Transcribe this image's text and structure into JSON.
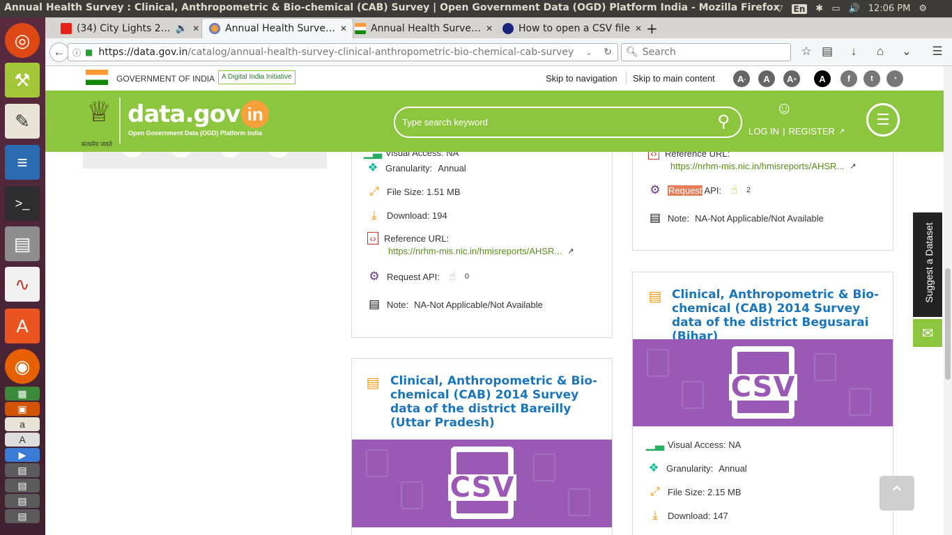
{
  "window": {
    "title": "Annual Health Survey : Clinical, Anthropometric & Bio-chemical (CAB) Survey | Open Government Data (OGD) Platform India - Mozilla Firefox",
    "keyboard": "En",
    "clock": "12:06 PM"
  },
  "tabs": [
    {
      "label": "(34) City Lights 2…"
    },
    {
      "label": "Annual Health Surve…"
    },
    {
      "label": "Annual Health Surve…"
    },
    {
      "label": "How to open a CSV file"
    }
  ],
  "browser": {
    "url_host": "https://data.gov.in",
    "url_path": "/catalog/annual-health-survey-clinical-anthropometric-bio-chemical-cab-survey",
    "search_placeholder": "Search"
  },
  "gov_strip": {
    "gov_label": "GOVERNMENT OF INDIA",
    "initiative": "A Digital India Initiative",
    "skip_nav": "Skip to navigation",
    "skip_main": "Skip to main content",
    "font_minus": "A",
    "font_normal": "A",
    "font_plus": "A",
    "contrast": "A"
  },
  "header": {
    "logo_main": "data.gov",
    "logo_in": "in",
    "logo_sub": "Open Government Data (OGD) Platform India",
    "emblem_motto": "सत्यमेव जयते",
    "search_placeholder": "Type search keyword",
    "login": "LOG IN",
    "separator": "|",
    "register": "REGISTER"
  },
  "card_left_top": {
    "visual_access": "Visual Access: NA",
    "granularity_label": "Granularity:",
    "granularity_value": "Annual",
    "file_size": "File Size: 1.51 MB",
    "download": "Download: 194",
    "reference_label": "Reference URL:",
    "reference_url": "https://nrhm-mis.nic.in/hmisreports/AHSR...",
    "request_api": "Request API:",
    "api_count": "0",
    "note_label": "Note:",
    "note_value": "NA-Not Applicable/Not Available"
  },
  "card_right_top": {
    "reference_label": "Reference URL:",
    "reference_url": "https://nrhm-mis.nic.in/hmisreports/AHSR...",
    "request_word": "Request",
    "api_word": "API:",
    "api_count": "2",
    "note_label": "Note:",
    "note_value": "NA-Not Applicable/Not Available"
  },
  "card_bareilly": {
    "title": "Clinical, Anthropometric & Bio-chemical (CAB) 2014 Survey data of the district Bareilly (Uttar Pradesh)",
    "csv": "CSV"
  },
  "card_begusarai": {
    "title": "Clinical, Anthropometric & Bio-chemical (CAB) 2014 Survey data of the district Begusarai (Bihar)",
    "csv": "CSV",
    "visual_access": "Visual Access: NA",
    "granularity_label": "Granularity:",
    "granularity_value": "Annual",
    "file_size": "File Size: 2.15 MB",
    "download": "Download: 147"
  },
  "sidebar_widgets": {
    "suggest": "Suggest a Dataset"
  },
  "colors": {
    "green": "#8cc63f",
    "purple": "#9b59b6",
    "title_blue": "#1b75bb",
    "link_green": "#5a8d19"
  }
}
